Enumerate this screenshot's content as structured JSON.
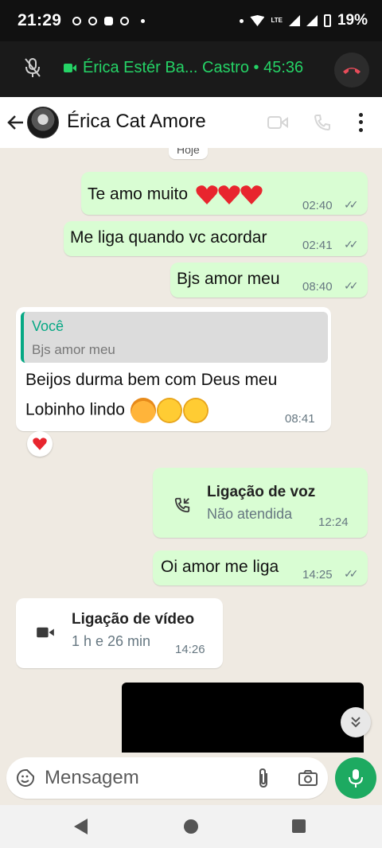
{
  "status_bar": {
    "time": "21:29",
    "network_small": "LTE",
    "battery": "19%"
  },
  "call_banner": {
    "title": "Érica Estér Ba... Castro • 45:36",
    "accent_color": "#25d366",
    "hangup_color": "#e74c5a"
  },
  "header": {
    "contact_name": "Érica Cat Amore"
  },
  "chat": {
    "date_chip": "Hoje",
    "messages": [
      {
        "text": "Te amo muito",
        "emoji": "❤️❤️❤️",
        "time": "02:40",
        "ticks": "✓✓"
      },
      {
        "text": "Me liga quando vc acordar",
        "time": "02:41",
        "ticks": "✓✓"
      },
      {
        "text": "Bjs amor meu",
        "time": "08:40",
        "ticks": "✓✓"
      },
      {
        "quote_author": "Você",
        "quote_text": "Bjs amor meu",
        "line1": "Beijos durma bem com Deus meu",
        "line2": "Lobinho lindo",
        "time": "08:41",
        "reaction": "❤️"
      },
      {
        "call_label": "Ligação de voz",
        "call_sub": "Não atendida",
        "time": "12:24"
      },
      {
        "text": "Oi amor me liga",
        "time": "14:25",
        "ticks": "✓✓"
      },
      {
        "call_label": "Ligação de vídeo",
        "call_sub": "1 h e 26 min",
        "time": "14:26"
      }
    ]
  },
  "composer": {
    "placeholder": "Mensagem"
  },
  "colors": {
    "outgoing_bubble": "#d9fdd3",
    "incoming_bubble": "#ffffff",
    "chat_background": "#efeae2",
    "mic_button": "#1daa61"
  }
}
